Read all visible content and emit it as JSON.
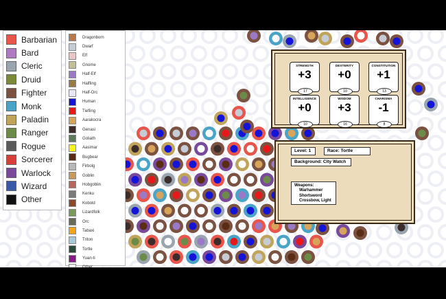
{
  "class_legend": [
    {
      "label": "Barbarian",
      "color": "#e8554b"
    },
    {
      "label": "Bard",
      "color": "#b07ac2"
    },
    {
      "label": "Cleric",
      "color": "#9aa4ae"
    },
    {
      "label": "Druid",
      "color": "#7a8a3a"
    },
    {
      "label": "Fighter",
      "color": "#7b5241"
    },
    {
      "label": "Monk",
      "color": "#4aa4c8"
    },
    {
      "label": "Paladin",
      "color": "#c0a45c"
    },
    {
      "label": "Ranger",
      "color": "#6c8a48"
    },
    {
      "label": "Rogue",
      "color": "#5a5a5a"
    },
    {
      "label": "Sorcerer",
      "color": "#d7403a"
    },
    {
      "label": "Warlock",
      "color": "#7a4a9a"
    },
    {
      "label": "Wizard",
      "color": "#3a58a8"
    },
    {
      "label": "Other",
      "color": "#111111"
    }
  ],
  "race_legend": [
    {
      "label": "Dragonborn",
      "color": "#b87a4a"
    },
    {
      "label": "Dwarf",
      "color": "#c6ccd6"
    },
    {
      "label": "Elf",
      "color": "#ecc6c6"
    },
    {
      "label": "Gnome",
      "color": "#c4be94"
    },
    {
      "label": "Half-Elf",
      "color": "#9a7ac6"
    },
    {
      "label": "Halfling",
      "color": "#9a7a44"
    },
    {
      "label": "Half-Orc",
      "color": "#e8e8f4"
    },
    {
      "label": "Human",
      "color": "#1414d8"
    },
    {
      "label": "Tiefling",
      "color": "#e81818"
    },
    {
      "label": "Aarakocra",
      "color": "#d8a45a"
    },
    {
      "label": "Genasi",
      "color": "#3c2c2c"
    },
    {
      "label": "Goliath",
      "color": "#5a7a5a"
    },
    {
      "label": "Aasimar",
      "color": "#f4f418"
    },
    {
      "label": "Bugbear",
      "color": "#5a2c14"
    },
    {
      "label": "Firbolg",
      "color": "#b8b8b8"
    },
    {
      "label": "Goblin",
      "color": "#c89a5a"
    },
    {
      "label": "Hobgoblin",
      "color": "#b8645a"
    },
    {
      "label": "Kenku",
      "color": "#7a7a7a"
    },
    {
      "label": "Kobold",
      "color": "#8a4a2a"
    },
    {
      "label": "Lizardfolk",
      "color": "#7a9a5a"
    },
    {
      "label": "Orc",
      "color": "#6a6a5a"
    },
    {
      "label": "Tabaxi",
      "color": "#f4a414"
    },
    {
      "label": "Triton",
      "color": "#a4c8d8"
    },
    {
      "label": "Tortle",
      "color": "#2a4a3a"
    },
    {
      "label": "Yuan-ti",
      "color": "#8a1a8a"
    },
    {
      "label": "Other",
      "color": "#ffffff"
    }
  ],
  "stats": [
    {
      "name": "STRENGTH",
      "mod": "+3",
      "score": "17"
    },
    {
      "name": "DEXTERITY",
      "mod": "+0",
      "score": "10"
    },
    {
      "name": "CONSTITUTION",
      "mod": "+1",
      "score": "13"
    },
    {
      "name": "INTELLIGENCE",
      "mod": "+0",
      "score": "10"
    },
    {
      "name": "WISDOM",
      "mod": "+3",
      "score": "16"
    },
    {
      "name": "CHARISMA",
      "mod": "-1",
      "score": "8"
    }
  ],
  "sheet": {
    "level": "Level: 1",
    "race": "Race: Tortle",
    "background": "Background: City Watch",
    "weapons_title": "Weapons:",
    "weapons": [
      "Warhammer",
      "Shortsword",
      "Crossbow, Light"
    ]
  },
  "colors": {
    "fighter_outer": "#7b5241",
    "human_inner": "#1414d8",
    "parchment": "#ecdcbc",
    "faded_ring": "#d8dce8"
  }
}
